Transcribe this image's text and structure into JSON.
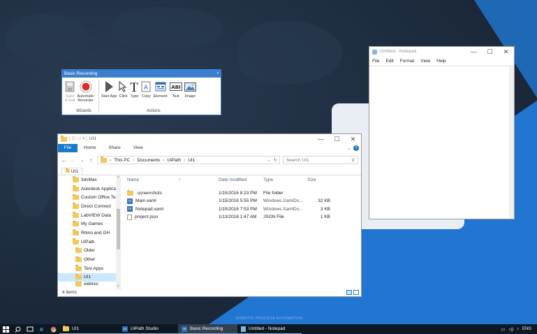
{
  "recorder": {
    "title": "Basic Recording",
    "buttons": {
      "save_exit": [
        "Save",
        "& Exit"
      ],
      "auto_recorder": [
        "Automatic",
        "Recorder"
      ],
      "start_app": "Start App",
      "click": "Click",
      "type": "Type",
      "copy": "Copy",
      "element": "Element",
      "text": "Text",
      "image": "Image"
    },
    "groups": {
      "wizards": "Wizards",
      "actions": "Actions"
    }
  },
  "explorer": {
    "title": "UI1",
    "ribbon_tabs": [
      "File",
      "Home",
      "Share",
      "View"
    ],
    "breadcrumb": [
      "This PC",
      "Documents",
      "UiPath",
      "UI1"
    ],
    "search_placeholder": "Search UI1",
    "tab": "UI1",
    "nav_items": [
      "3dsMax",
      "Autodesk Applicat",
      "Custom Office Ter",
      "Direct Connect",
      "LabVIEW Data",
      "My Games",
      "Rhino and GH",
      "UiPath",
      "Older",
      "Other",
      "Test Apps",
      "UI1",
      "webrec"
    ],
    "columns": [
      "Name",
      "Date modified",
      "Type",
      "Size"
    ],
    "files": [
      {
        "name": ".screenshots",
        "date": "1/15/2016 8:23 PM",
        "type": "File folder",
        "size": "",
        "icon": "folder-icon"
      },
      {
        "name": "Main.xaml",
        "date": "1/15/2016 5:55 PM",
        "type": "Windows.XamlDo...",
        "size": "32 KB",
        "icon": "uipath-file-icon"
      },
      {
        "name": "Notepad.xaml",
        "date": "1/15/2016 7:53 PM",
        "type": "Windows.XamlDo...",
        "size": "3 KB",
        "icon": "uipath-file-icon"
      },
      {
        "name": "project.json",
        "date": "1/13/2016 1:47 AM",
        "type": "JSON File",
        "size": "1 KB",
        "icon": "file-icon"
      }
    ],
    "status": "4 items"
  },
  "notepad": {
    "title": "Untitled - Notepad",
    "menu": [
      "File",
      "Edit",
      "Format",
      "View",
      "Help"
    ]
  },
  "desktop": {
    "watermark": "ROBOTIC PROCESS AUTOMATION"
  },
  "taskbar": {
    "tasks": [
      {
        "label": "UI1",
        "icon": "folder-icon"
      },
      {
        "label": "UiPath Studio",
        "icon": "uipath-icon"
      },
      {
        "label": "Basic Recording",
        "icon": "uipath-icon"
      },
      {
        "label": "Untitled - Notepad",
        "icon": "notepad-icon"
      }
    ],
    "language": "ENG"
  },
  "colors": {
    "accent": "#3c7fcf",
    "explorer_file_tab": "#1979ca",
    "desktop_blue": "#2176d2",
    "selection": "#cce8ff"
  }
}
